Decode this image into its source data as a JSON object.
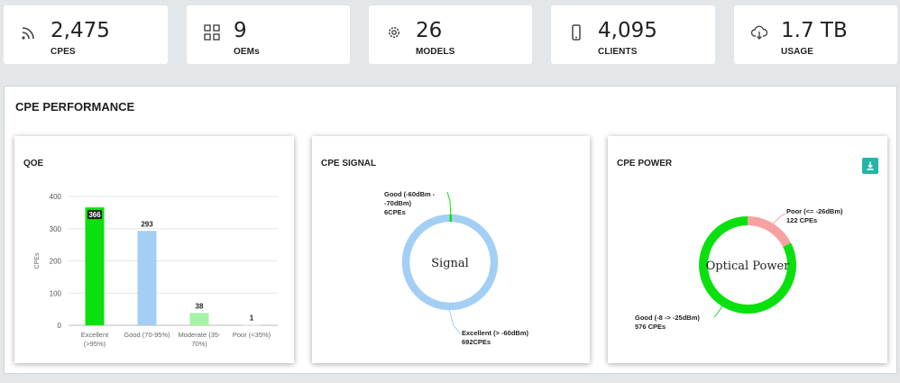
{
  "stats": [
    {
      "icon": "rss-icon",
      "value": "2,475",
      "label": "CPES"
    },
    {
      "icon": "grid-icon",
      "value": "9",
      "label": "OEMs"
    },
    {
      "icon": "gear-icon",
      "value": "26",
      "label": "MODELS"
    },
    {
      "icon": "phone-icon",
      "value": "4,095",
      "label": "CLIENTS"
    },
    {
      "icon": "cloud-download-icon",
      "value": "1.7 TB",
      "label": "USAGE"
    }
  ],
  "panel": {
    "title": "CPE PERFORMANCE"
  },
  "qoe": {
    "title": "QOE",
    "chart_data": {
      "type": "bar",
      "title": "QOE",
      "ylabel": "CPEs",
      "ylim": [
        0,
        400
      ],
      "yticks": [
        0,
        100,
        200,
        300,
        400
      ],
      "categories": [
        "Excellent (>95%)",
        "Good (70-95%)",
        "Moderate (35-70%)",
        "Poor (<35%)"
      ],
      "category_lines": [
        [
          "Excellent",
          "(>95%)"
        ],
        [
          "Good (70-95%)"
        ],
        [
          "Moderate (35-",
          "70%)"
        ],
        [
          "Poor (<35%)"
        ]
      ],
      "values": [
        366,
        293,
        38,
        1
      ],
      "colors": [
        "#0be00f",
        "#a3cff5",
        "#a5f3a5",
        "#dddddd"
      ]
    }
  },
  "signal": {
    "title": "CPE SIGNAL",
    "chart_data": {
      "type": "pie",
      "center_label": "Signal",
      "slices": [
        {
          "label_lines": [
            "Good (-60dBm -",
            "-70dBm)",
            "6CPEs"
          ],
          "value": 6,
          "color": "#0be00f"
        },
        {
          "label_lines": [
            "Excellent (> -60dBm)",
            "692CPEs"
          ],
          "value": 692,
          "color": "#a3cff5"
        }
      ]
    }
  },
  "power": {
    "title": "CPE POWER",
    "download_icon": "download-icon",
    "chart_data": {
      "type": "pie",
      "center_label": "Optical Power",
      "slices": [
        {
          "label_lines": [
            "Poor (<= -26dBm)",
            "122 CPEs"
          ],
          "value": 122,
          "color": "#f7a2a2"
        },
        {
          "label_lines": [
            "Good (-8 -> -25dBm)",
            "576 CPEs"
          ],
          "value": 576,
          "color": "#0be00f"
        }
      ]
    }
  }
}
